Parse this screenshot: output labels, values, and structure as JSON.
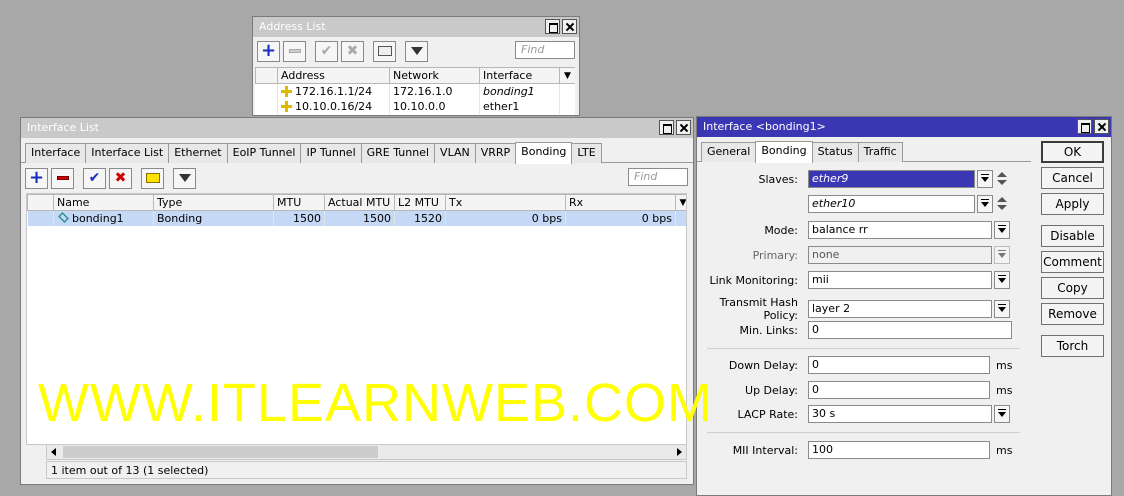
{
  "address_list": {
    "title": "Address List",
    "find_placeholder": "Find",
    "columns": [
      "Address",
      "Network",
      "Interface"
    ],
    "rows": [
      {
        "address": "172.16.1.1/24",
        "network": "172.16.1.0",
        "interface": "bonding1"
      },
      {
        "address": "10.10.0.16/24",
        "network": "10.10.0.0",
        "interface": "ether1"
      }
    ]
  },
  "interface_list": {
    "title": "Interface List",
    "tabs": [
      "Interface",
      "Interface List",
      "Ethernet",
      "EoIP Tunnel",
      "IP Tunnel",
      "GRE Tunnel",
      "VLAN",
      "VRRP",
      "Bonding",
      "LTE"
    ],
    "active_tab": "Bonding",
    "find_placeholder": "Find",
    "columns": [
      "Name",
      "Type",
      "MTU",
      "Actual MTU",
      "L2 MTU",
      "Tx",
      "Rx"
    ],
    "rows": [
      {
        "name": "bonding1",
        "type": "Bonding",
        "mtu": "1500",
        "actual_mtu": "1500",
        "l2_mtu": "1520",
        "tx": "0 bps",
        "rx": "0 bps"
      }
    ],
    "status": "1 item out of 13 (1 selected)"
  },
  "interface_dialog": {
    "title": "Interface <bonding1>",
    "tabs": [
      "General",
      "Bonding",
      "Status",
      "Traffic"
    ],
    "active_tab": "Bonding",
    "fields": {
      "slaves_label": "Slaves:",
      "slave1": "ether9",
      "slave2": "ether10",
      "mode_label": "Mode:",
      "mode": "balance rr",
      "primary_label": "Primary:",
      "primary": "none",
      "link_monitoring_label": "Link Monitoring:",
      "link_monitoring": "mii",
      "hash_policy_label": "Transmit Hash Policy:",
      "hash_policy": "layer 2",
      "min_links_label": "Min. Links:",
      "min_links": "0",
      "down_delay_label": "Down Delay:",
      "down_delay": "0",
      "up_delay_label": "Up Delay:",
      "up_delay": "0",
      "lacp_rate_label": "LACP Rate:",
      "lacp_rate": "30 s",
      "mii_interval_label": "MII Interval:",
      "mii_interval": "100",
      "unit_ms": "ms"
    },
    "buttons": [
      "OK",
      "Cancel",
      "Apply",
      "Disable",
      "Comment",
      "Copy",
      "Remove",
      "Torch"
    ]
  },
  "watermark": "WWW.ITLEARNWEB.COM"
}
